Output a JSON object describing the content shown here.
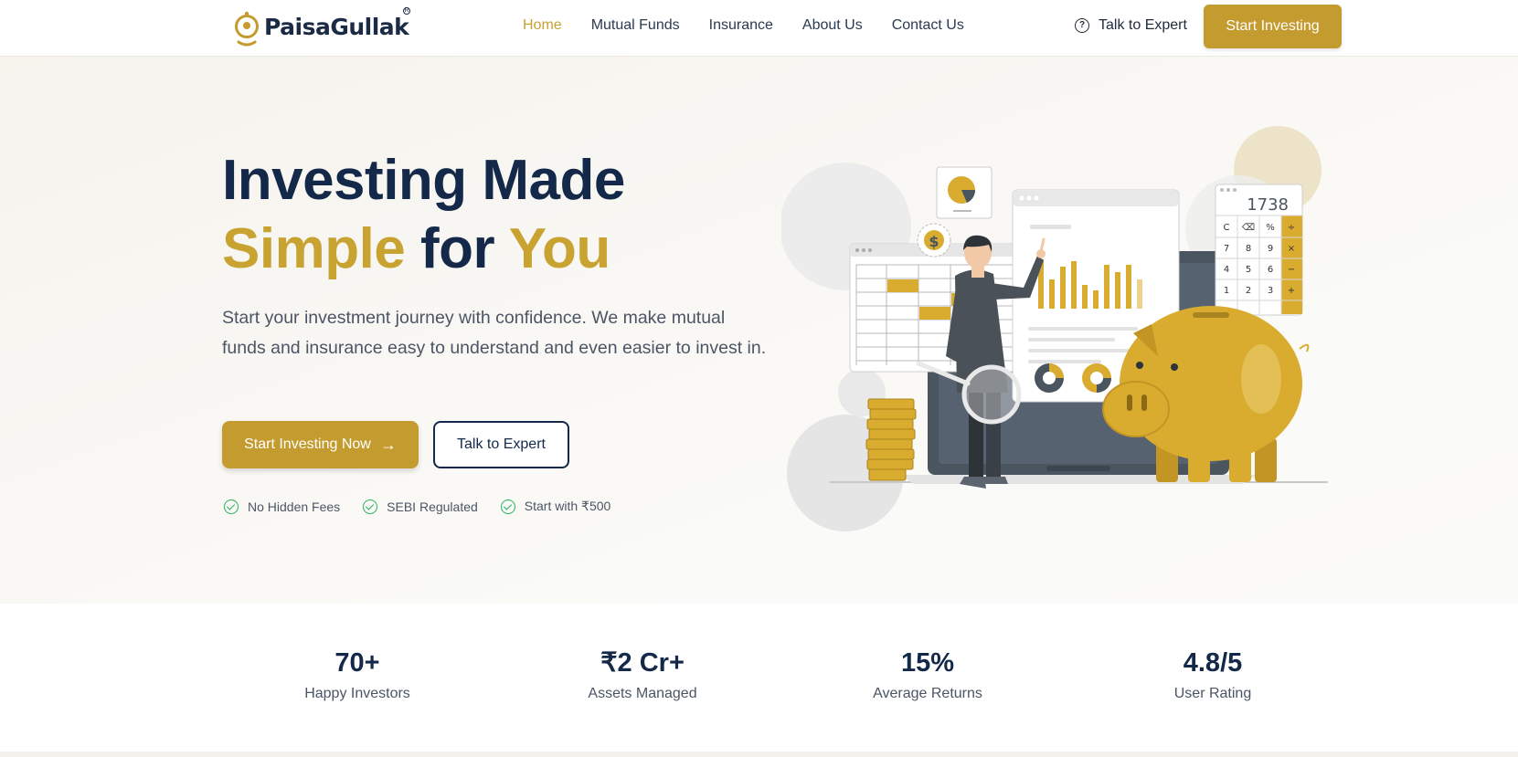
{
  "brand": {
    "name": "PaisaGullak",
    "accent": "#c49b2f",
    "navy": "#14294a"
  },
  "nav": {
    "links": [
      {
        "label": "Home",
        "active": true
      },
      {
        "label": "Mutual Funds",
        "active": false
      },
      {
        "label": "Insurance",
        "active": false
      },
      {
        "label": "About Us",
        "active": false
      },
      {
        "label": "Contact Us",
        "active": false
      }
    ],
    "talk_label": "Talk to Expert",
    "talk_icon": "question-circle-icon",
    "cta_label": "Start Investing"
  },
  "hero": {
    "title_line1": "Investing Made",
    "title_word_gold1": "Simple",
    "title_word_mid": " for ",
    "title_word_gold2": "You",
    "subtitle": "Start your investment journey with confidence. We make mutual funds and insurance easy to understand and even easier to invest in.",
    "primary_cta": "Start Investing Now",
    "primary_icon": "arrow-right-icon",
    "secondary_cta": "Talk to Expert",
    "features": [
      {
        "label": "No Hidden Fees",
        "icon": "check-circle-icon"
      },
      {
        "label": "SEBI Regulated",
        "icon": "check-circle-icon"
      },
      {
        "label": "Start with ₹500",
        "icon": "check-circle-icon"
      }
    ]
  },
  "illustration": {
    "calculator_display": "1738",
    "calculator_keys": [
      "C",
      "⌫",
      "%",
      "÷",
      "7",
      "8",
      "9",
      "×",
      "4",
      "5",
      "6",
      "−",
      "1",
      "2",
      "3",
      "+"
    ],
    "coin_symbol": "$"
  },
  "stats": [
    {
      "value": "70+",
      "label": "Happy Investors"
    },
    {
      "value": "₹2 Cr+",
      "label": "Assets Managed"
    },
    {
      "value": "15%",
      "label": "Average Returns"
    },
    {
      "value": "4.8/5",
      "label": "User Rating"
    }
  ]
}
